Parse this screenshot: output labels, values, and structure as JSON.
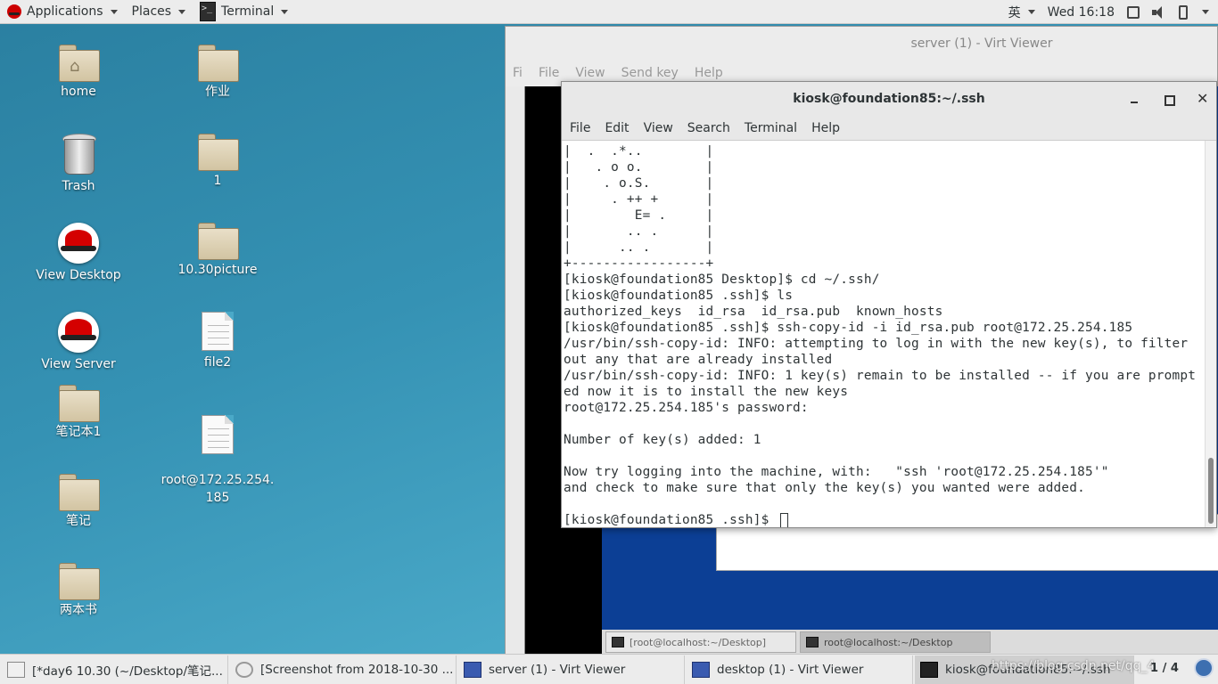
{
  "topbar": {
    "applications": "Applications",
    "places": "Places",
    "active_app": "Terminal",
    "input_method": "英",
    "clock": "Wed 16:18"
  },
  "desktop": {
    "icons": [
      {
        "label": "home",
        "kind": "folder-home"
      },
      {
        "label": "作业",
        "kind": "folder"
      },
      {
        "label": "Trash",
        "kind": "trash"
      },
      {
        "label": "1",
        "kind": "folder"
      },
      {
        "label": "View Desktop",
        "kind": "redhat"
      },
      {
        "label": "10.30picture",
        "kind": "folder"
      },
      {
        "label": "View Server",
        "kind": "redhat"
      },
      {
        "label": "file2",
        "kind": "document"
      },
      {
        "label": "笔记本1",
        "kind": "folder"
      },
      {
        "label": "root@172.25.254.\n185",
        "kind": "document"
      },
      {
        "label": "笔记",
        "kind": "folder"
      },
      {
        "label": "两本书",
        "kind": "folder"
      }
    ]
  },
  "virt_viewer": {
    "title": "server (1) - Virt Viewer",
    "menu": [
      "Fi",
      "File",
      "View",
      "Send key",
      "Help"
    ],
    "guest_tasks": [
      "[root@localhost:~/Desktop]",
      "root@localhost:~/Desktop"
    ]
  },
  "terminal": {
    "title": "kiosk@foundation85:~/.ssh",
    "menu": [
      "File",
      "Edit",
      "View",
      "Search",
      "Terminal",
      "Help"
    ],
    "lines": [
      "|  .  .*..        |",
      "|   . o o.        |",
      "|    . o.S.       |",
      "|     . ++ +      |",
      "|        E= .     |",
      "|       .. .      |",
      "|      .. .       |",
      "+-----------------+",
      "[kiosk@foundation85 Desktop]$ cd ~/.ssh/",
      "[kiosk@foundation85 .ssh]$ ls",
      "authorized_keys  id_rsa  id_rsa.pub  known_hosts",
      "[kiosk@foundation85 .ssh]$ ssh-copy-id -i id_rsa.pub root@172.25.254.185",
      "/usr/bin/ssh-copy-id: INFO: attempting to log in with the new key(s), to filter",
      "out any that are already installed",
      "/usr/bin/ssh-copy-id: INFO: 1 key(s) remain to be installed -- if you are prompt",
      "ed now it is to install the new keys",
      "root@172.25.254.185's password: ",
      "",
      "Number of key(s) added: 1",
      "",
      "Now try logging into the machine, with:   \"ssh 'root@172.25.254.185'\"",
      "and check to make sure that only the key(s) you wanted were added.",
      ""
    ],
    "prompt": "[kiosk@foundation85 .ssh]$ "
  },
  "taskbar": {
    "tasks": [
      {
        "label": "[*day6 10.30 (~/Desktop/笔记...",
        "icon": "text-editor-icon"
      },
      {
        "label": "[Screenshot from 2018-10-30 ...",
        "icon": "screenshot-icon"
      },
      {
        "label": "server (1) - Virt Viewer",
        "icon": "virt-viewer-icon"
      },
      {
        "label": "desktop (1) - Virt Viewer",
        "icon": "virt-viewer-icon"
      },
      {
        "label": "kiosk@foundation85:~/.ssh",
        "icon": "terminal-icon"
      }
    ],
    "watermark": "https://blog.csdn.net/qq_4",
    "pager": "1 / 4"
  }
}
